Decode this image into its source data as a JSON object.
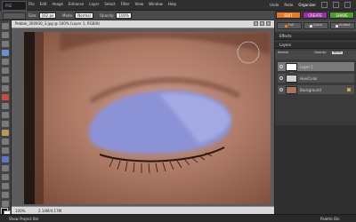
{
  "app": {
    "logo_text": "PSE",
    "menu": [
      "File",
      "Edit",
      "Image",
      "Enhance",
      "Layer",
      "Select",
      "Filter",
      "View",
      "Window",
      "Help"
    ],
    "right": {
      "undo_label": "Undo",
      "redo_label": "Redo",
      "organizer_label": "Organizer"
    }
  },
  "options_bar": {
    "size_label": "Size:",
    "size_value": "162 px",
    "mode_label": "Mode:",
    "mode_value": "Normal",
    "opacity_label": "Opacity:",
    "opacity_value": "100%"
  },
  "mode_tabs": [
    {
      "label": "EDIT",
      "color": "#e8791e"
    },
    {
      "label": "CREATE",
      "color": "#9b2fa8"
    },
    {
      "label": "SHARE",
      "color": "#4e9a2a"
    }
  ],
  "document": {
    "title": "Pebble_300930_3.jpg @ 100% (Layer 1, RGB/8)",
    "zoom": "100%",
    "info": "2.14M/4.17M"
  },
  "panel": {
    "edit_buttons": [
      "Full",
      "Quick",
      "Guided"
    ],
    "effects_label": "Effects",
    "layers_label": "Layers",
    "blend_mode": "Normal",
    "opacity_label": "Opacity:",
    "opacity_value": "100%",
    "layers": [
      {
        "name": "Layer 1",
        "selected": true
      },
      {
        "name": "Hue/Color",
        "selected": false
      },
      {
        "name": "Background",
        "selected": false
      }
    ]
  },
  "status": {
    "project_bin_label": "Show Project Bin",
    "palette_bin_label": "Palette Bin"
  },
  "colors": {
    "skin": "#b07d68",
    "eye_mask": "#8b93d6",
    "accent_orange": "#e8791e"
  }
}
